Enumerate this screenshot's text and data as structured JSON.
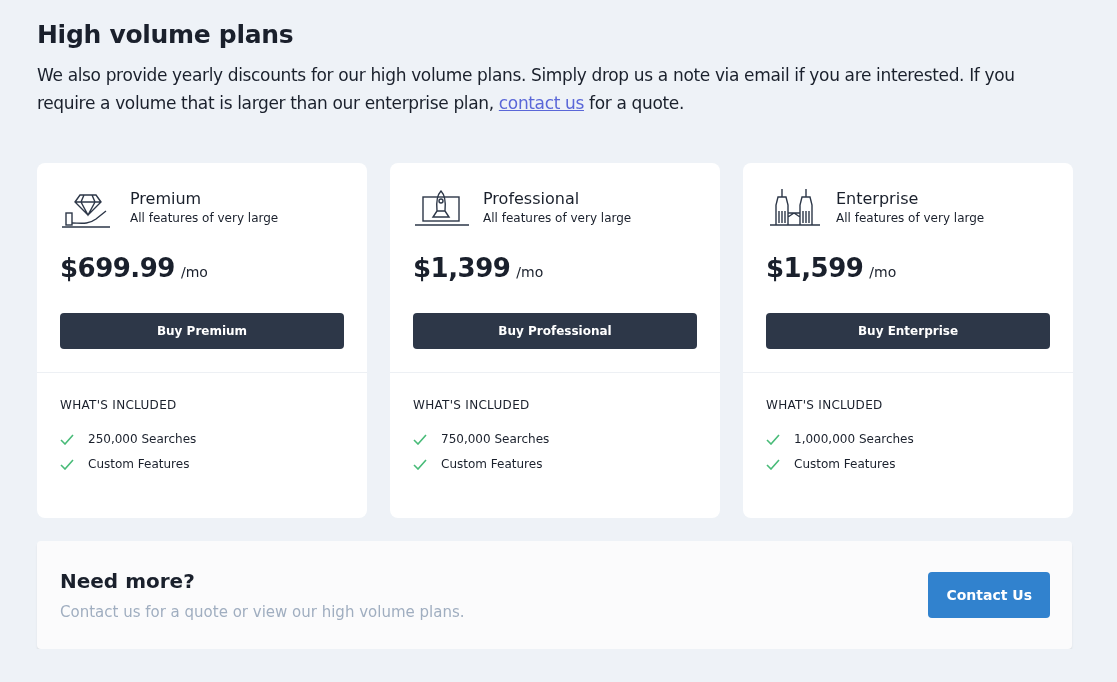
{
  "heading": "High volume plans",
  "intro": {
    "before": "We also provide yearly discounts for our high volume plans. Simply drop us a note via email if you are interested. If you require a volume that is larger than our enterprise plan,",
    "link": "contact us",
    "after": "for a quote."
  },
  "plans": [
    {
      "name": "Premium",
      "subtitle": "All features of very large",
      "price": "$699.99",
      "period": "/mo",
      "button": "Buy Premium",
      "included_title": "WHAT'S INCLUDED",
      "features": [
        "250,000 Searches",
        "Custom Features"
      ]
    },
    {
      "name": "Professional",
      "subtitle": "All features of very large",
      "price": "$1,399",
      "period": "/mo",
      "button": "Buy Professional",
      "included_title": "WHAT'S INCLUDED",
      "features": [
        "750,000 Searches",
        "Custom Features"
      ]
    },
    {
      "name": "Enterprise",
      "subtitle": "All features of very large",
      "price": "$1,599",
      "period": "/mo",
      "button": "Buy Enterprise",
      "included_title": "WHAT'S INCLUDED",
      "features": [
        "1,000,000 Searches",
        "Custom Features"
      ]
    }
  ],
  "banner": {
    "title": "Need more?",
    "text": "Contact us for a quote or view our high volume plans.",
    "button": "Contact Us"
  }
}
